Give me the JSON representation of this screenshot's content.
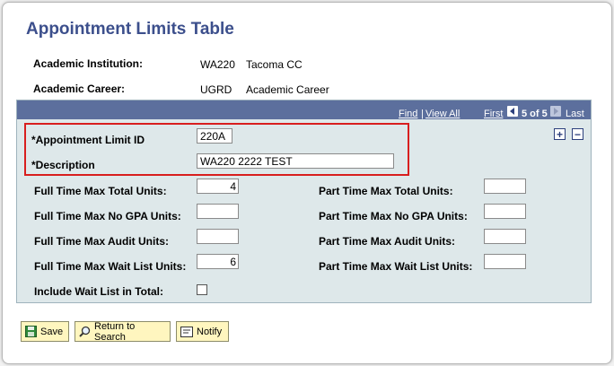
{
  "page": {
    "title": "Appointment Limits Table"
  },
  "header": {
    "institution_label": "Academic Institution:",
    "institution_code": "WA220",
    "institution_name": "Tacoma CC",
    "career_label": "Academic Career:",
    "career_code": "UGRD",
    "career_name": "Academic Career"
  },
  "nav": {
    "find": "Find",
    "separator": "|",
    "view_all": "View All",
    "first": "First",
    "position": "5 of 5",
    "last": "Last"
  },
  "form": {
    "limit_id_label": "*Appointment Limit ID",
    "limit_id_value": "220A",
    "description_label": "*Description",
    "description_value": "WA220 2222 TEST",
    "ft_total_label": "Full Time Max Total Units:",
    "ft_total_value": "4",
    "ft_nogpa_label": "Full Time Max No GPA Units:",
    "ft_nogpa_value": "",
    "ft_audit_label": "Full Time Max Audit Units:",
    "ft_audit_value": "",
    "ft_wait_label": "Full Time Max Wait List Units:",
    "ft_wait_value": "6",
    "pt_total_label": "Part Time Max Total Units:",
    "pt_total_value": "",
    "pt_nogpa_label": "Part Time Max No GPA Units:",
    "pt_nogpa_value": "",
    "pt_audit_label": "Part Time Max Audit Units:",
    "pt_audit_value": "",
    "pt_wait_label": "Part Time Max Wait List Units:",
    "pt_wait_value": "",
    "include_wait_label": "Include Wait List in Total:",
    "include_wait_checked": false
  },
  "buttons": {
    "save": "Save",
    "return": "Return to Search",
    "notify": "Notify"
  },
  "icons": {
    "save": "save-disk-icon",
    "return": "magnifier-icon",
    "notify": "notify-note-icon",
    "prev": "arrow-left-icon",
    "next": "arrow-right-icon",
    "add": "plus-icon",
    "delete": "minus-icon"
  },
  "colors": {
    "title": "#3c4f8c",
    "nav_bar": "#5c6f9d",
    "panel_bg": "#dee8ea",
    "highlight": "#d81e1e",
    "button_bg": "#fff6bf"
  }
}
